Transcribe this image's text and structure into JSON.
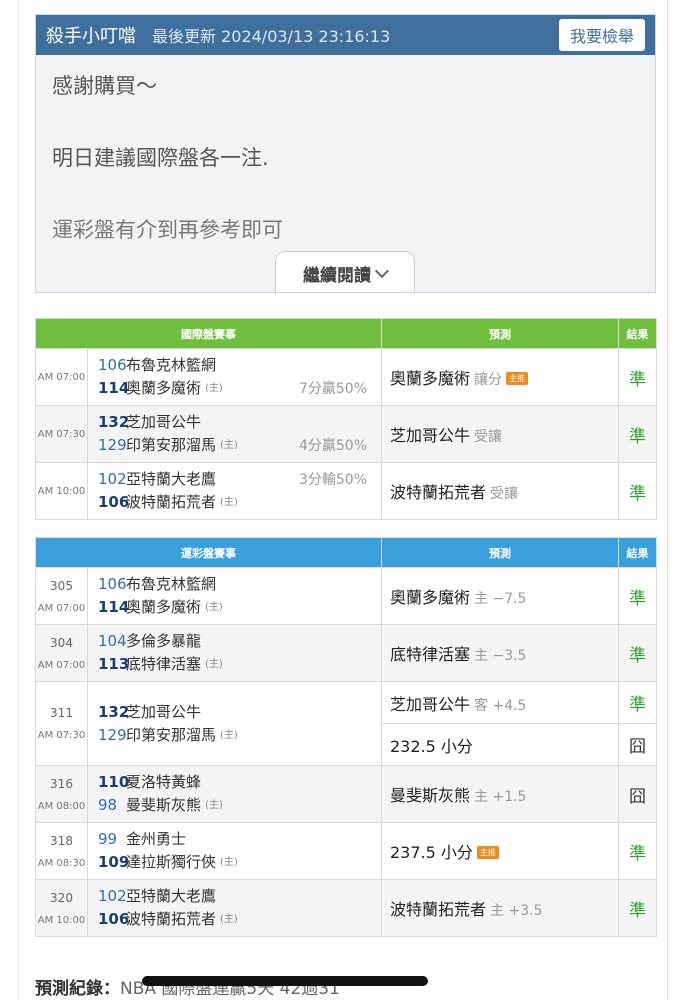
{
  "post": {
    "author": "殺手小叮噹",
    "updated": "最後更新 2024/03/13 23:16:13",
    "report_label": "我要檢舉",
    "paragraphs": [
      "感謝購買～",
      "明日建議國際盤各一注.",
      "運彩盤有介到再參考即可"
    ],
    "read_more": "繼續閱讀"
  },
  "intl_table": {
    "headers": [
      "國際盤賽事",
      "預測",
      "結果"
    ],
    "rows": [
      {
        "time": "AM 07:00",
        "away_score": "106",
        "away": "布魯克林籃網",
        "home_score": "114",
        "home": "奧蘭多魔術",
        "home_tag": "(主)",
        "margin": "7分贏50%",
        "pick": "奧蘭多魔術",
        "pick_sub": "讓分",
        "hot": "主推",
        "result": "準"
      },
      {
        "time": "AM 07:30",
        "away_score": "132",
        "away": "芝加哥公牛",
        "home_score": "129",
        "home": "印第安那溜馬",
        "home_tag": "(主)",
        "margin": "4分贏50%",
        "pick": "芝加哥公牛",
        "pick_sub": "受讓",
        "result": "準"
      },
      {
        "time": "AM 10:00",
        "away_score": "102",
        "away": "亞特蘭大老鷹",
        "home_score": "106",
        "home": "波特蘭拓荒者",
        "home_tag": "(主)",
        "margin": "3分輸50%",
        "pick": "波特蘭拓荒者",
        "pick_sub": "受讓",
        "result": "準"
      }
    ]
  },
  "sport_table": {
    "headers": [
      "運彩盤賽事",
      "預測",
      "結果"
    ],
    "rows": [
      {
        "num": "305",
        "time": "AM 07:00",
        "away_score": "106",
        "away": "布魯克林籃網",
        "home_score": "114",
        "home": "奧蘭多魔術",
        "home_tag": "(主)",
        "pick": "奧蘭多魔術",
        "pick_sub": "主 −7.5",
        "result": "準"
      },
      {
        "num": "304",
        "time": "AM 07:00",
        "away_score": "104",
        "away": "多倫多暴龍",
        "home_score": "113",
        "home": "底特律活塞",
        "home_tag": "(主)",
        "pick": "底特律活塞",
        "pick_sub": "主 −3.5",
        "result": "準"
      },
      {
        "num": "311",
        "time": "AM 07:30",
        "away_score": "132",
        "away": "芝加哥公牛",
        "home_score": "129",
        "home": "印第安那溜馬",
        "home_tag": "(主)",
        "pick": "芝加哥公牛",
        "pick_sub": "客 +4.5",
        "result": "準",
        "pick2": "232.5 小分",
        "result2": "囧"
      },
      {
        "num": "316",
        "time": "AM 08:00",
        "away_score": "110",
        "away": "夏洛特黃蜂",
        "home_score": "98",
        "home": "曼斐斯灰熊",
        "home_tag": "(主)",
        "pick": "曼斐斯灰熊",
        "pick_sub": "主 +1.5",
        "result": "囧"
      },
      {
        "num": "318",
        "time": "AM 08:30",
        "away_score": "99",
        "away": "金州勇士",
        "home_score": "109",
        "home": "達拉斯獨行俠",
        "home_tag": "(主)",
        "pick": "237.5 小分",
        "hot": "主推",
        "result": "準"
      },
      {
        "num": "320",
        "time": "AM 10:00",
        "away_score": "102",
        "away": "亞特蘭大老鷹",
        "home_score": "106",
        "home": "波特蘭拓荒者",
        "home_tag": "(主)",
        "pick": "波特蘭拓荒者",
        "pick_sub": "主 +3.5",
        "result": "準"
      }
    ]
  },
  "footer": {
    "label": "預測紀錄：",
    "value": "NBA 國際盤連贏5天 42過31"
  }
}
